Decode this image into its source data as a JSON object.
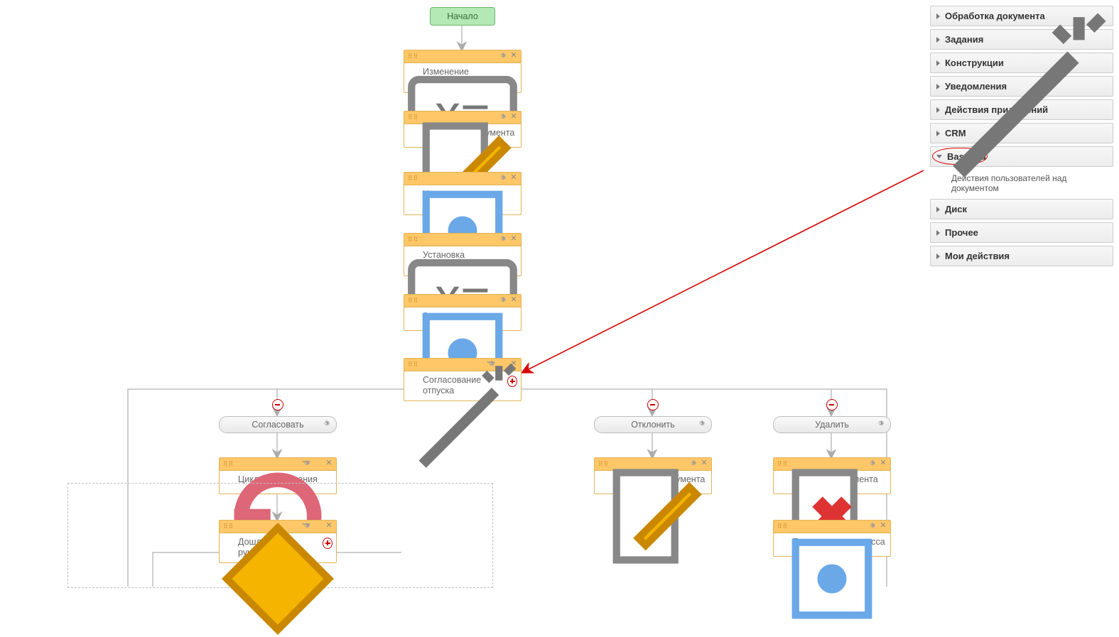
{
  "start": {
    "label": "Начало"
  },
  "nodes": {
    "change_vars": {
      "label": "Изменение переменных"
    },
    "change_doc": {
      "label": "Изменение документа"
    },
    "set_rights": {
      "label": "Установка прав: автору"
    },
    "set_approver": {
      "label": "Установка утверждающего"
    },
    "log_report": {
      "label": "Запись в отчет"
    },
    "vacation": {
      "label": "Согласование отпуска"
    },
    "cycle": {
      "label": "Цикл согласования"
    },
    "reached_mgmt": {
      "label": "Дошли до руководства"
    },
    "change_doc2": {
      "label": "Изменение документа"
    },
    "delete_doc": {
      "label": "Удаление документа"
    },
    "abort": {
      "label": "Прерывание процесса"
    }
  },
  "branches": {
    "approve": {
      "label": "Согласовать"
    },
    "reject": {
      "label": "Отклонить"
    },
    "delete": {
      "label": "Удалить"
    }
  },
  "palette": {
    "items": [
      {
        "label": "Обработка документа"
      },
      {
        "label": "Задания"
      },
      {
        "label": "Конструкции"
      },
      {
        "label": "Уведомления"
      },
      {
        "label": "Действия приложений"
      },
      {
        "label": "CRM"
      },
      {
        "label": "Base8.ru"
      },
      {
        "label": "Диск"
      },
      {
        "label": "Прочее"
      },
      {
        "label": "Мои действия"
      }
    ],
    "base8_sub": "Действия пользователей над документом"
  }
}
